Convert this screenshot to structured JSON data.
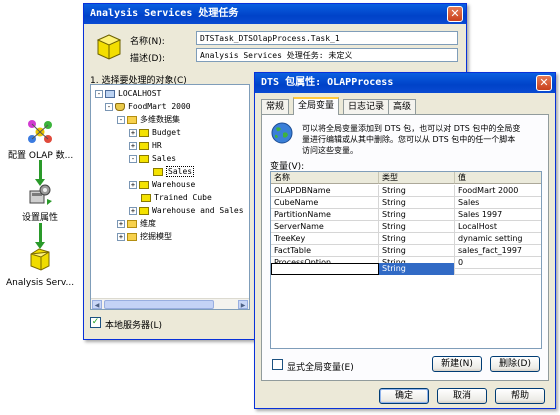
{
  "designer": {
    "tasks": [
      {
        "label": "配置 OLAP 数...",
        "icon": "olap-configure-icon"
      },
      {
        "label": "设置属性",
        "icon": "dynamic-properties-icon"
      },
      {
        "label": "Analysis Serv...",
        "icon": "analysis-services-task-icon"
      }
    ]
  },
  "task_window": {
    "title": "Analysis Services 处理任务",
    "name_label": "名称(N):",
    "name_value": "DTSTask_DTSOlapProcess.Task_1",
    "desc_label": "描述(D):",
    "desc_value": "Analysis Services 处理任务: 未定义",
    "select_label": "1. 选择要处理的对象(C)",
    "tree": [
      {
        "text": "LOCALHOST",
        "icon": "server-icon",
        "expander": "-"
      },
      {
        "text": "FoodMart 2000",
        "icon": "database-icon",
        "expander": "-"
      },
      {
        "text": "多维数据集",
        "icon": "folder-icon",
        "expander": "-"
      },
      {
        "text": "Budget",
        "icon": "cube-icon",
        "expander": "+"
      },
      {
        "text": "HR",
        "icon": "cube-icon",
        "expander": "+"
      },
      {
        "text": "Sales",
        "icon": "cube-icon",
        "expander": "-"
      },
      {
        "text": "Sales",
        "icon": "partition-icon",
        "expander": ""
      },
      {
        "text": "Warehouse",
        "icon": "cube-icon",
        "expander": "+"
      },
      {
        "text": "Trained Cube",
        "icon": "cube-icon",
        "expander": ""
      },
      {
        "text": "Warehouse and Sales",
        "icon": "cube-icon",
        "expander": "+"
      },
      {
        "text": "维度",
        "icon": "folder-icon",
        "expander": "+"
      },
      {
        "text": "挖掘模型",
        "icon": "folder-icon",
        "expander": "+"
      }
    ],
    "local_server_label": "本地服务器(L)",
    "local_server_checked": true
  },
  "props_window": {
    "title": "DTS 包属性: OLAPProcess",
    "tabs": [
      "常规",
      "全局变量",
      "日志记录",
      "高级"
    ],
    "active_tab": 1,
    "info_text_1": "可以将全局变量添加到 DTS 包，也可以对 DTS 包中的全局变",
    "info_text_2": "量进行编辑或从其中删除。您可以从 DTS 包中的任一个脚本",
    "info_text_3": "访问这些变量。",
    "variables_label": "变量(V):",
    "columns": [
      "名称",
      "类型",
      "值"
    ],
    "rows": [
      [
        "OLAPDBName",
        "String",
        "FoodMart 2000"
      ],
      [
        "CubeName",
        "String",
        "Sales"
      ],
      [
        "PartitionName",
        "String",
        "Sales 1997"
      ],
      [
        "ServerName",
        "String",
        "LocalHost"
      ],
      [
        "TreeKey",
        "String",
        "dynamic setting"
      ],
      [
        "FactTable",
        "String",
        "sales_fact_1997"
      ],
      [
        "ProcessOption",
        "String",
        "0"
      ]
    ],
    "edit_row": [
      "",
      "String",
      ""
    ],
    "show_globals_label": "显式全局变量(E)",
    "new_button": "新建(N)",
    "delete_button": "删除(D)",
    "ok_button": "确定",
    "cancel_button": "取消",
    "help_button": "帮助"
  }
}
